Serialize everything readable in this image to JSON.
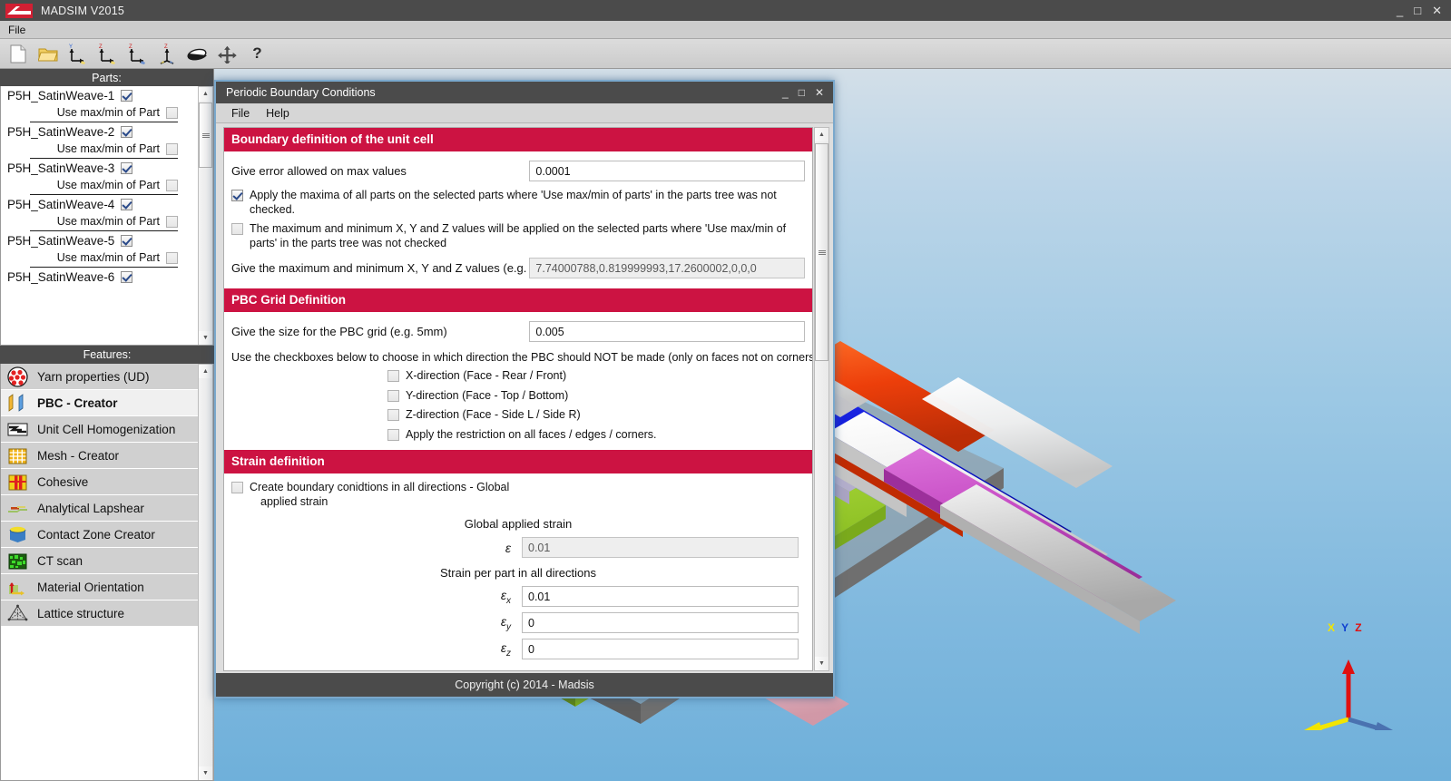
{
  "app": {
    "title": "MADSIM V2015",
    "logo_icon": "madsim-logo-icon",
    "window_controls": {
      "minimize": "_",
      "maximize": "□",
      "close": "✕"
    },
    "menu": [
      {
        "label": "File"
      }
    ],
    "toolbar": [
      {
        "name": "new-file-icon",
        "tip": "New"
      },
      {
        "name": "open-folder-icon",
        "tip": "Open"
      },
      {
        "name": "axis-xy-icon",
        "tip": "View XY"
      },
      {
        "name": "axis-zx-icon",
        "tip": "View ZX"
      },
      {
        "name": "axis-zy-icon",
        "tip": "View ZY"
      },
      {
        "name": "axis-iso-icon",
        "tip": "Isometric view"
      },
      {
        "name": "rotate-icon",
        "tip": "Rotate"
      },
      {
        "name": "pan-move-icon",
        "tip": "Pan"
      },
      {
        "name": "help-question-icon",
        "tip": "Help"
      }
    ]
  },
  "sidebar": {
    "parts": {
      "header": "Parts:",
      "sub_label": "Use max/min of Part",
      "items": [
        {
          "label": "P5H_SatinWeave-1",
          "checked": true,
          "sub_checked": false
        },
        {
          "label": "P5H_SatinWeave-2",
          "checked": true,
          "sub_checked": false
        },
        {
          "label": "P5H_SatinWeave-3",
          "checked": true,
          "sub_checked": false
        },
        {
          "label": "P5H_SatinWeave-4",
          "checked": true,
          "sub_checked": false
        },
        {
          "label": "P5H_SatinWeave-5",
          "checked": true,
          "sub_checked": false
        },
        {
          "label": "P5H_SatinWeave-6",
          "checked": true,
          "sub_checked": false
        }
      ]
    },
    "features": {
      "header": "Features:",
      "items": [
        {
          "label": "Yarn properties (UD)",
          "icon": "yarn-cross-section-icon",
          "selected": false
        },
        {
          "label": "PBC - Creator",
          "icon": "pbc-planes-icon",
          "selected": true
        },
        {
          "label": "Unit Cell Homogenization",
          "icon": "homogenization-icon",
          "selected": false
        },
        {
          "label": "Mesh - Creator",
          "icon": "mesh-grid-icon",
          "selected": false
        },
        {
          "label": "Cohesive",
          "icon": "cohesive-layers-icon",
          "selected": false
        },
        {
          "label": "Analytical Lapshear",
          "icon": "lapshear-icon",
          "selected": false
        },
        {
          "label": "Contact Zone Creator",
          "icon": "contact-zone-cylinder-icon",
          "selected": false
        },
        {
          "label": "CT scan",
          "icon": "ct-scan-icon",
          "selected": false
        },
        {
          "label": "Material Orientation",
          "icon": "material-orientation-axes-icon",
          "selected": false
        },
        {
          "label": "Lattice structure",
          "icon": "lattice-structure-icon",
          "selected": false
        }
      ]
    }
  },
  "viewport": {
    "triad": {
      "x_label": "X",
      "y_label": "Y",
      "z_label": "Z"
    },
    "colors": {
      "background_top": "#d3dfe8",
      "background_bottom": "#6fb0da",
      "yarn_khaki": "#d9d182",
      "yarn_grey": "#c9c9c9",
      "yarn_white": "#efefef",
      "yarn_lavender": "#d9d4e8",
      "yarn_orange": "#ee3c06",
      "yarn_blue": "#0b16d6",
      "yarn_magenta": "#c64bc4",
      "yarn_pink": "#f0bfcb",
      "yarn_green": "#8dc024",
      "base_plate": "#6f6f6f"
    }
  },
  "dialog": {
    "title": "Periodic Boundary Conditions",
    "window_controls": {
      "minimize": "_",
      "maximize": "□",
      "close": "✕"
    },
    "menu": [
      {
        "label": "File"
      },
      {
        "label": "Help"
      }
    ],
    "status": "Copyright (c) 2014 - Madsis",
    "accent_color": "#cc1342",
    "sections": [
      {
        "heading": "Boundary definition of the unit cell",
        "error_label": "Give error allowed on max values",
        "error_value": "0.0001",
        "apply_maxima_label": "Apply the maxima of all parts on the selected parts where 'Use max/min of parts' in the parts tree was not checked.",
        "apply_maxima_checked": true,
        "minmax_label": "The maximum and minimum X, Y and Z values will be applied on the selected parts where 'Use max/min of parts' in the parts tree was not checked",
        "minmax_checked": false,
        "values_label": "Give the maximum and minimum X, Y and Z values (e.g. Xma",
        "values_value": "7.74000788,0.819999993,17.2600002,0,0,0"
      },
      {
        "heading": "PBC Grid Definition",
        "grid_label": "Give the size for the PBC grid (e.g. 5mm)",
        "grid_value": "0.005",
        "note": "Use the checkboxes below to choose in which direction the PBC should NOT be made (only on faces not on corners nor ed",
        "checkboxes": [
          {
            "label": "X-direction (Face - Rear / Front)",
            "checked": false
          },
          {
            "label": "Y-direction (Face - Top / Bottom)",
            "checked": false
          },
          {
            "label": "Z-direction (Face - Side L / Side R)",
            "checked": false
          },
          {
            "label": "Apply the restriction on all faces / edges / corners.",
            "checked": false
          }
        ]
      },
      {
        "heading": "Strain definition",
        "create_bc_label_line1": "Create boundary conidtions in all directions - Global",
        "create_bc_label_line2": "applied strain",
        "create_bc_checked": false,
        "global_strain_title": "Global applied strain",
        "global_strain_symbol": "ε",
        "global_strain_value": "0.01",
        "global_strain_readonly": true,
        "per_part_title": "Strain per part in all directions",
        "per_part": [
          {
            "symbol": "ε",
            "sub": "x",
            "value": "0.01"
          },
          {
            "symbol": "ε",
            "sub": "y",
            "value": "0"
          },
          {
            "symbol": "ε",
            "sub": "z",
            "value": "0"
          }
        ]
      }
    ]
  }
}
